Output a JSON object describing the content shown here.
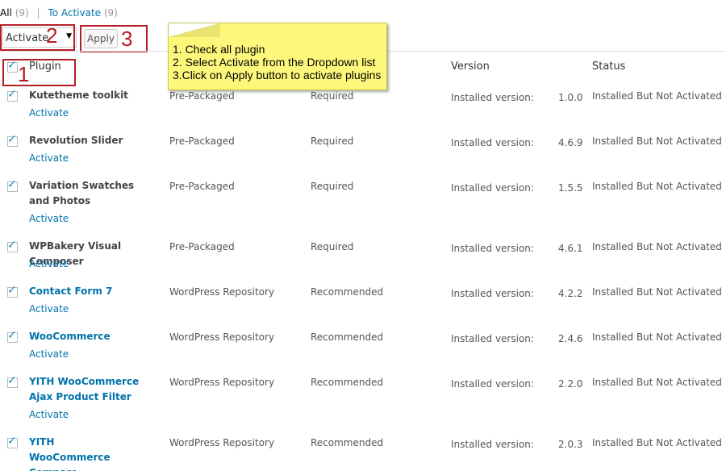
{
  "views": {
    "all_label": "All",
    "all_count": "(9)",
    "separator": "|",
    "to_activate_label": "To Activate",
    "to_activate_count": "(9)"
  },
  "bulk": {
    "selected": "Activate",
    "arrow": "▼",
    "apply_label": "Apply"
  },
  "annotations": {
    "n1": "1",
    "n2": "2",
    "n3": "3",
    "callout_lines": [
      "1. Check all plugin",
      "2. Select Activate from the Dropdown list",
      "3.Click on Apply button to activate plugins"
    ]
  },
  "table": {
    "headers": {
      "plugin": "Plugin",
      "version": "Version",
      "status": "Status"
    },
    "version_prefix": "Installed version:",
    "action_label": "Activate",
    "rows": [
      {
        "name": "Kutetheme toolkit",
        "source": "Pre-Packaged",
        "type": "Required",
        "version": "1.0.0",
        "status": "Installed But Not Activated"
      },
      {
        "name": "Revolution Slider",
        "source": "Pre-Packaged",
        "type": "Required",
        "version": "4.6.9",
        "status": "Installed But Not Activated"
      },
      {
        "name": "Variation Swatches and Photos",
        "source": "Pre-Packaged",
        "type": "Required",
        "version": "1.5.5",
        "status": "Installed But Not Activated"
      },
      {
        "name": "WPBakery Visual Composer",
        "source": "Pre-Packaged",
        "type": "Required",
        "version": "4.6.1",
        "status": "Installed But Not Activated"
      },
      {
        "name": "Contact Form 7",
        "source": "WordPress Repository",
        "type": "Recommended",
        "version": "4.2.2",
        "status": "Installed But Not Activated"
      },
      {
        "name": "WooCommerce",
        "source": "WordPress Repository",
        "type": "Recommended",
        "version": "2.4.6",
        "status": "Installed But Not Activated"
      },
      {
        "name": "YITH WooCommerce Ajax Product Filter",
        "source": "WordPress Repository",
        "type": "Recommended",
        "version": "2.2.0",
        "status": "Installed But Not Activated"
      },
      {
        "name": "YITH WooCommerce Compare",
        "source": "WordPress Repository",
        "type": "Recommended",
        "version": "2.0.3",
        "status": "Installed But Not Activated"
      }
    ]
  },
  "colors": {
    "link": "#0073aa",
    "annotation_red": "#b41d26",
    "callout_yellow": "#fdf87b",
    "checkbox_tick": "#1e8cbe"
  }
}
